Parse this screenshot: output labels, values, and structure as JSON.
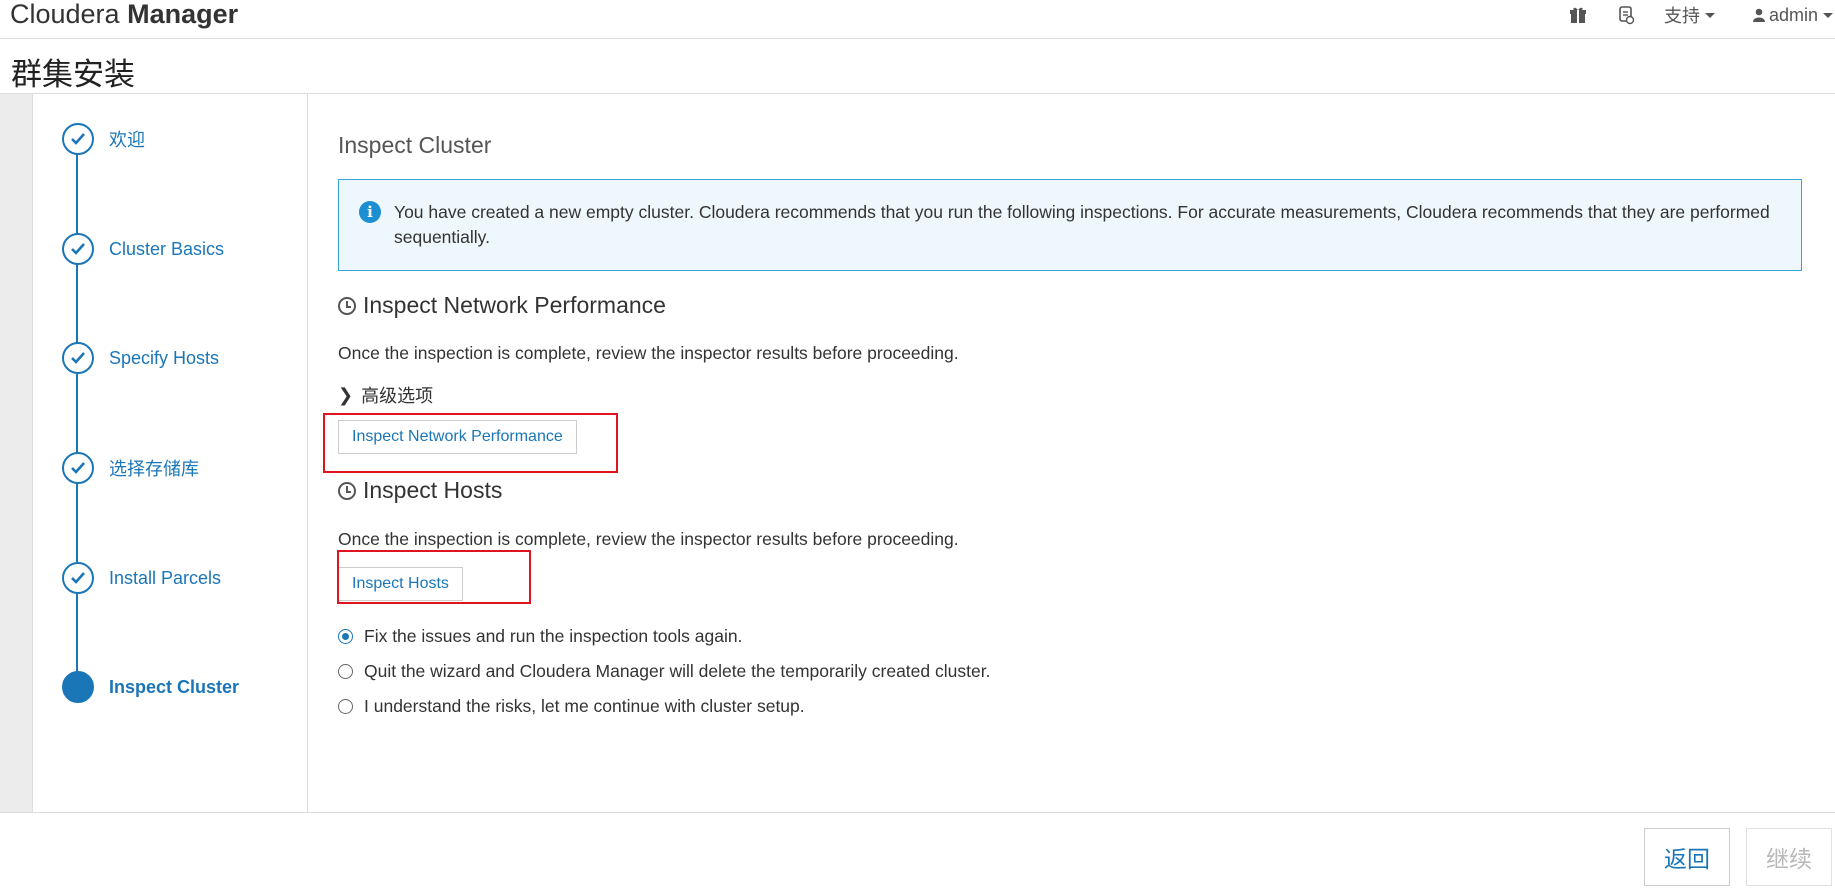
{
  "header": {
    "brand_light": "Cloudera ",
    "brand_bold": "Manager",
    "gift_icon": "gift-icon",
    "notes_icon": "release-notes-icon",
    "support_label": "支持",
    "user_label": "admin"
  },
  "page": {
    "title": "群集安装"
  },
  "steps": [
    {
      "label": "欢迎",
      "state": "done"
    },
    {
      "label": "Cluster Basics",
      "state": "done"
    },
    {
      "label": "Specify Hosts",
      "state": "done"
    },
    {
      "label": "选择存储库",
      "state": "done"
    },
    {
      "label": "Install Parcels",
      "state": "done"
    },
    {
      "label": "Inspect Cluster",
      "state": "active"
    }
  ],
  "main": {
    "title": "Inspect Cluster",
    "alert": "You have created a new empty cluster. Cloudera recommends that you run the following inspections. For accurate measurements, Cloudera recommends that they are performed sequentially.",
    "network": {
      "title": "Inspect Network Performance",
      "desc": "Once the inspection is complete, review the inspector results before proceeding.",
      "advanced_label": "高级选项",
      "button_label": "Inspect Network Performance"
    },
    "hosts": {
      "title": "Inspect Hosts",
      "desc": "Once the inspection is complete, review the inspector results before proceeding.",
      "button_label": "Inspect Hosts"
    },
    "options": [
      {
        "label": "Fix the issues and run the inspection tools again.",
        "checked": true
      },
      {
        "label": "Quit the wizard and Cloudera Manager will delete the temporarily created cluster.",
        "checked": false
      },
      {
        "label": "I understand the risks, let me continue with cluster setup.",
        "checked": false
      }
    ]
  },
  "footer": {
    "back_label": "返回",
    "continue_label": "继续"
  },
  "colors": {
    "accent": "#1b76b8",
    "alert_border": "#35a6d9",
    "alert_bg": "#eef7fb",
    "highlight": "#e0141e"
  }
}
